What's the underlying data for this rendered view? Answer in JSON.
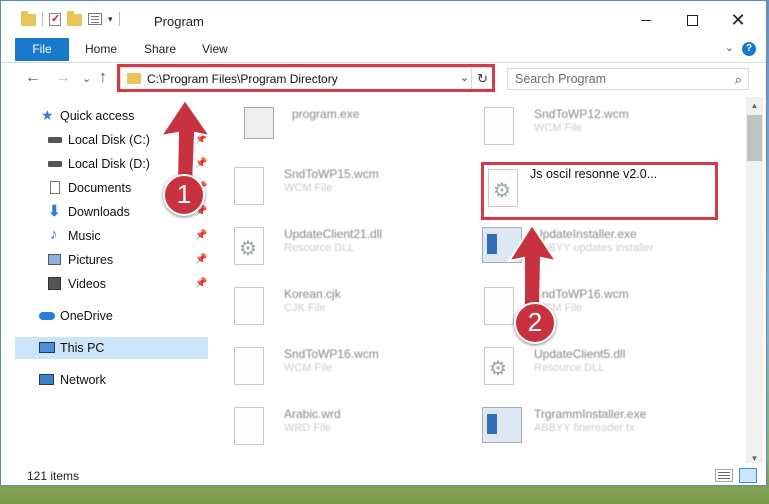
{
  "window": {
    "title": "Program",
    "minimize": "minimize",
    "maximize": "maximize",
    "close": "✕"
  },
  "ribbon": {
    "tabs": [
      "File",
      "Home",
      "Share",
      "View"
    ],
    "help": "?"
  },
  "nav": {
    "back": "←",
    "forward": "→",
    "recent": "⌄",
    "up": "↑",
    "address": "C:\\Program Files\\Program Directory",
    "refresh": "↻",
    "search_placeholder": "Search Program",
    "search_icon": "⌕"
  },
  "sidebar": {
    "quick_access": "Quick access",
    "items": [
      {
        "label": "Local Disk (C:)",
        "icon": "drive-icon"
      },
      {
        "label": "Local Disk (D:)",
        "icon": "drive-icon"
      },
      {
        "label": "Documents",
        "icon": "documents-icon"
      },
      {
        "label": "Downloads",
        "icon": "downloads-icon"
      },
      {
        "label": "Music",
        "icon": "music-icon"
      },
      {
        "label": "Pictures",
        "icon": "pictures-icon"
      },
      {
        "label": "Videos",
        "icon": "videos-icon"
      }
    ],
    "onedrive": "OneDrive",
    "this_pc": "This PC",
    "network": "Network"
  },
  "files": [
    {
      "name": "program.exe",
      "desc": ""
    },
    {
      "name": "SndToWP12.wcm",
      "desc": "WCM File"
    },
    {
      "name": "SndToWP15.wcm",
      "desc": "WCM File"
    },
    {
      "name": "Js oscil resonne v2.0...",
      "desc": ""
    },
    {
      "name": "UpdateClient21.dll",
      "desc": "Resource DLL"
    },
    {
      "name": "UpdateInstaller.exe",
      "desc": "ABBYY updates installer"
    },
    {
      "name": "Korean.cjk",
      "desc": "CJK File"
    },
    {
      "name": "SndToWP16.wcm",
      "desc": "WCM File"
    },
    {
      "name": "SndToWP16.wcm",
      "desc": "WCM File"
    },
    {
      "name": "UpdateClient5.dll",
      "desc": "Resource DLL"
    },
    {
      "name": "Arabic.wrd",
      "desc": "WRD File"
    },
    {
      "name": "TrgrammInstaller.exe",
      "desc": "ABBYY finereader tx"
    }
  ],
  "status": {
    "count": "121 items"
  },
  "annotations": {
    "step1": "1",
    "step2": "2",
    "highlight_color": "#d23b47"
  }
}
